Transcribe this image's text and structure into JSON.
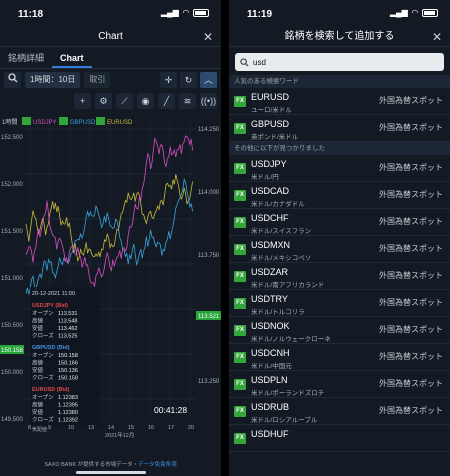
{
  "left": {
    "status_time": "11:18",
    "title": "Chart",
    "tabs": [
      "銘柄詳細",
      "Chart"
    ],
    "timeframe": "1時間：10日",
    "trade": "取引",
    "chart": {
      "period_label": "1時間",
      "legend": [
        "USDJPY",
        "GBPUSD",
        "EURUSD"
      ],
      "colors": {
        "USDJPY": "#d54fc0",
        "GBPUSD": "#3aa3d8",
        "EURUSD": "#c8b93a"
      },
      "left_ticks": [
        "152.500",
        "152.000",
        "151.500",
        "151.000",
        "150.500",
        "150.000",
        "149.500"
      ],
      "right_ticks": [
        "114.250",
        "114.000",
        "113.750",
        "113.500",
        "113.250"
      ],
      "left_price_tag": "150.158",
      "right_price_tag": "113.521",
      "x_ticks": [
        "8",
        "9",
        "10",
        "13",
        "14",
        "15",
        "16",
        "17",
        "20"
      ],
      "x_month": "2021年12月",
      "time_overlay": "00:41:28",
      "tooltip": {
        "date": "20-12-2021 11:00",
        "blocks": [
          {
            "title": "USDJPY (Bid)",
            "color": "#e0494a",
            "rows": [
              [
                "オープン",
                "113.531"
              ],
              [
                "高値",
                "113.548"
              ],
              [
                "安値",
                "113.462"
              ],
              [
                "クローズ",
                "113.525"
              ]
            ]
          },
          {
            "title": "GBPUSD (Bid)",
            "color": "#4a8fe0",
            "rows": [
              [
                "オープン",
                "150.158"
              ],
              [
                "高値",
                "150.166"
              ],
              [
                "安値",
                "150.136"
              ],
              [
                "クローズ",
                "150.158"
              ]
            ]
          },
          {
            "title": "EURUSD (Bid)",
            "color": "#e0494a",
            "rows": [
              [
                "オープン",
                "1.12383"
              ],
              [
                "高値",
                "1.12395"
              ],
              [
                "安値",
                "1.12380"
              ],
              [
                "クローズ",
                "1.12392"
              ]
            ]
          }
        ],
        "footer": "気配値"
      }
    },
    "footer_text": "SAXO BANK が提供する市場データ・",
    "footer_link": "データ免責条項"
  },
  "right": {
    "status_time": "11:19",
    "title": "銘柄を検索して追加する",
    "search_value": "usd",
    "popular_header": "人気のある検索ワード",
    "found_header": "その他に以下が見つかりました",
    "popular": [
      {
        "symbol": "EURUSD",
        "name": "ユーロ/米ドル",
        "category": "外国為替スポット"
      },
      {
        "symbol": "GBPUSD",
        "name": "英ポンド/米ドル",
        "category": "外国為替スポット"
      }
    ],
    "found": [
      {
        "symbol": "USDJPY",
        "name": "米ドル/円",
        "category": "外国為替スポット"
      },
      {
        "symbol": "USDCAD",
        "name": "米ドル/カナダドル",
        "category": "外国為替スポット"
      },
      {
        "symbol": "USDCHF",
        "name": "米ドル/スイスフラン",
        "category": "外国為替スポット"
      },
      {
        "symbol": "USDMXN",
        "name": "米ドル/メキシコペソ",
        "category": "外国為替スポット"
      },
      {
        "symbol": "USDZAR",
        "name": "米ドル/南アフリカランド",
        "category": "外国為替スポット"
      },
      {
        "symbol": "USDTRY",
        "name": "米ドル/トルコリラ",
        "category": "外国為替スポット"
      },
      {
        "symbol": "USDNOK",
        "name": "米ドル/ノルウェークローネ",
        "category": "外国為替スポット"
      },
      {
        "symbol": "USDCNH",
        "name": "米ドル/中国元",
        "category": "外国為替スポット"
      },
      {
        "symbol": "USDPLN",
        "name": "米ドル/ポーランドズロチ",
        "category": "外国為替スポット"
      },
      {
        "symbol": "USDRUB",
        "name": "米ドル/ロシアルーブル",
        "category": "外国為替スポット"
      },
      {
        "symbol": "USDHUF",
        "name": "",
        "category": ""
      }
    ],
    "fx_badge": "FX"
  }
}
